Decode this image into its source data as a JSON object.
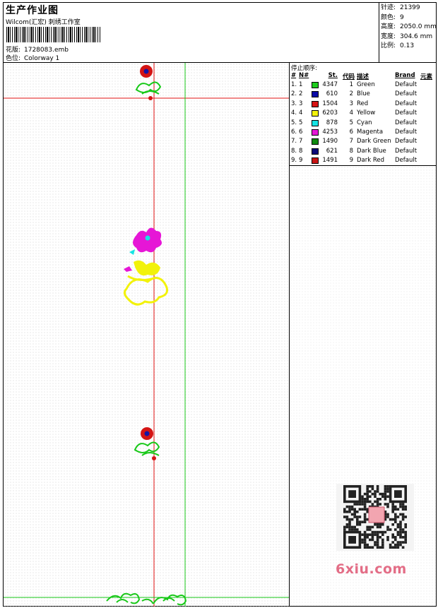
{
  "header": {
    "title": "生产作业图",
    "company": "Wilcom(汇宏) 刺绣工作室",
    "design_label": "花版:",
    "design_file": "1728083.emb",
    "colorway_label": "色位:",
    "colorway": "Colorway 1"
  },
  "specs": {
    "stitches_label": "针迹:",
    "stitches": "21399",
    "colors_label": "颜色:",
    "colors": "9",
    "height_label": "高度:",
    "height": "2050.0 mm",
    "width_label": "宽度:",
    "width": "304.6 mm",
    "scale_label": "比例:",
    "scale": "0.13"
  },
  "stops": {
    "title": "停止顺序:",
    "headers": {
      "seq": "#",
      "no": "N#",
      "st": "St.",
      "code": "代码",
      "desc": "描述",
      "brand": "Brand",
      "elem": "元素"
    },
    "rows": [
      {
        "seq": "1.",
        "no": "1",
        "color": "#1ecc1e",
        "st": "4347",
        "code": "1",
        "desc": "Green",
        "brand": "Default"
      },
      {
        "seq": "2.",
        "no": "2",
        "color": "#0a0aa6",
        "st": "610",
        "code": "2",
        "desc": "Blue",
        "brand": "Default"
      },
      {
        "seq": "3.",
        "no": "3",
        "color": "#d61414",
        "st": "1504",
        "code": "3",
        "desc": "Red",
        "brand": "Default"
      },
      {
        "seq": "4.",
        "no": "4",
        "color": "#f2f20a",
        "st": "6203",
        "code": "4",
        "desc": "Yellow",
        "brand": "Default"
      },
      {
        "seq": "5.",
        "no": "5",
        "color": "#16e4e4",
        "st": "878",
        "code": "5",
        "desc": "Cyan",
        "brand": "Default"
      },
      {
        "seq": "6.",
        "no": "6",
        "color": "#e616d6",
        "st": "4253",
        "code": "6",
        "desc": "Magenta",
        "brand": "Default"
      },
      {
        "seq": "7.",
        "no": "7",
        "color": "#0f8a0f",
        "st": "1490",
        "code": "7",
        "desc": "Dark Green",
        "brand": "Default"
      },
      {
        "seq": "8.",
        "no": "8",
        "color": "#0a0a7a",
        "st": "621",
        "code": "8",
        "desc": "Dark Blue",
        "brand": "Default"
      },
      {
        "seq": "9.",
        "no": "9",
        "color": "#c81414",
        "st": "1491",
        "code": "9",
        "desc": "Dark Red",
        "brand": "Default"
      }
    ]
  },
  "watermark": {
    "text": "6xiu.com"
  }
}
